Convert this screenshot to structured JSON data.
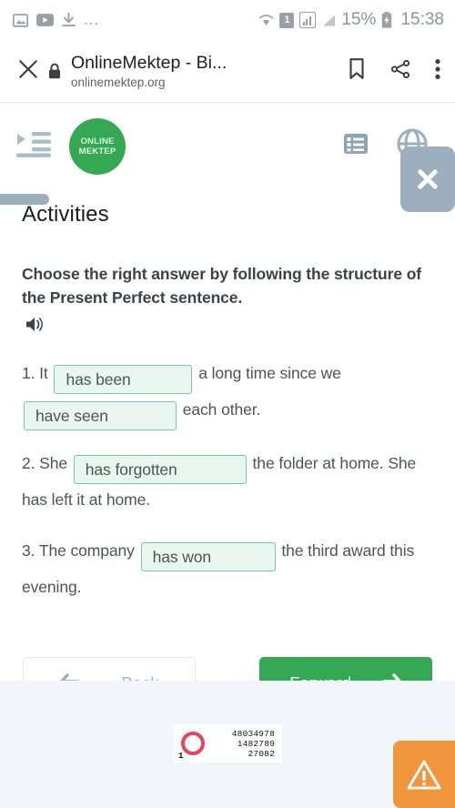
{
  "statusbar": {
    "left_icons": [
      "image-icon",
      "video-icon",
      "download-icon"
    ],
    "overflow": "...",
    "right_icons": [
      "wifi-icon",
      "sim-icon",
      "signal-icon",
      "signal-bars-icon",
      "battery-icon"
    ],
    "sim_label": "1",
    "battery_percent": "15%",
    "clock": "15:38"
  },
  "browser": {
    "close_label": "close-icon",
    "lock_label": "lock-icon",
    "title": "OnlineMektep - Bi...",
    "url": "onlinemektep.org",
    "bookmark_label": "bookmark-icon",
    "share_label": "share-icon",
    "menu_label": "more-vertical-icon"
  },
  "site_header": {
    "menu_icon": "indent-list-icon",
    "logo_line1": "ONLINE",
    "logo_line2": "MEKTEP",
    "list_icon": "list-view-icon",
    "globe_icon": "globe-icon",
    "overlay_close_icon": "close-icon"
  },
  "main": {
    "page_title": "Activities",
    "prompt": "Choose the right answer by following the structure of the Present Perfect sentence.",
    "audio_icon": "speaker-icon",
    "questions": [
      {
        "number": "1.",
        "parts": [
          {
            "type": "text",
            "value": "It"
          },
          {
            "type": "blank",
            "value": "has been"
          },
          {
            "type": "text",
            "value": "a long time since we"
          },
          {
            "type": "blank",
            "value": "have seen"
          },
          {
            "type": "text",
            "value": "each other."
          }
        ]
      },
      {
        "number": "2.",
        "parts": [
          {
            "type": "text",
            "value": "She"
          },
          {
            "type": "blank",
            "value": "has forgotten"
          },
          {
            "type": "text",
            "value": "the folder at home. She has left it at home."
          }
        ]
      },
      {
        "number": "3.",
        "parts": [
          {
            "type": "text",
            "value": "The company"
          },
          {
            "type": "blank",
            "value": "has won"
          },
          {
            "type": "text",
            "value": "the third award this evening."
          }
        ]
      }
    ],
    "back_label": "Back",
    "back_icon": "arrow-left-icon",
    "forward_label": "Forward",
    "forward_icon": "arrow-right-icon"
  },
  "footer": {
    "ad_counter_index": "1",
    "ad_number_1": "48034978",
    "ad_number_2": "1482789",
    "ad_number_3": "27082",
    "warning_icon": "warning-triangle-icon"
  },
  "colors": {
    "brand_green": "#35a853",
    "blank_border": "#79c6a8",
    "blank_fill": "#eaf7f0",
    "grey_chip": "#9bafbe",
    "warning_orange": "#f0963d",
    "footer_bg": "#f2f5f9",
    "ad_ring_red": "#e8435a"
  },
  "q1p0": "It",
  "q1b0": "has been",
  "q1p1": "a long time since we",
  "q1b1": "have seen",
  "q1p2": "each other.",
  "q2p0": "She",
  "q2b0": "has forgotten",
  "q2p1": "the folder at home. She has left it at home.",
  "q3p0": "The company",
  "q3b0": "has won",
  "q3p1": "the third award this evening."
}
